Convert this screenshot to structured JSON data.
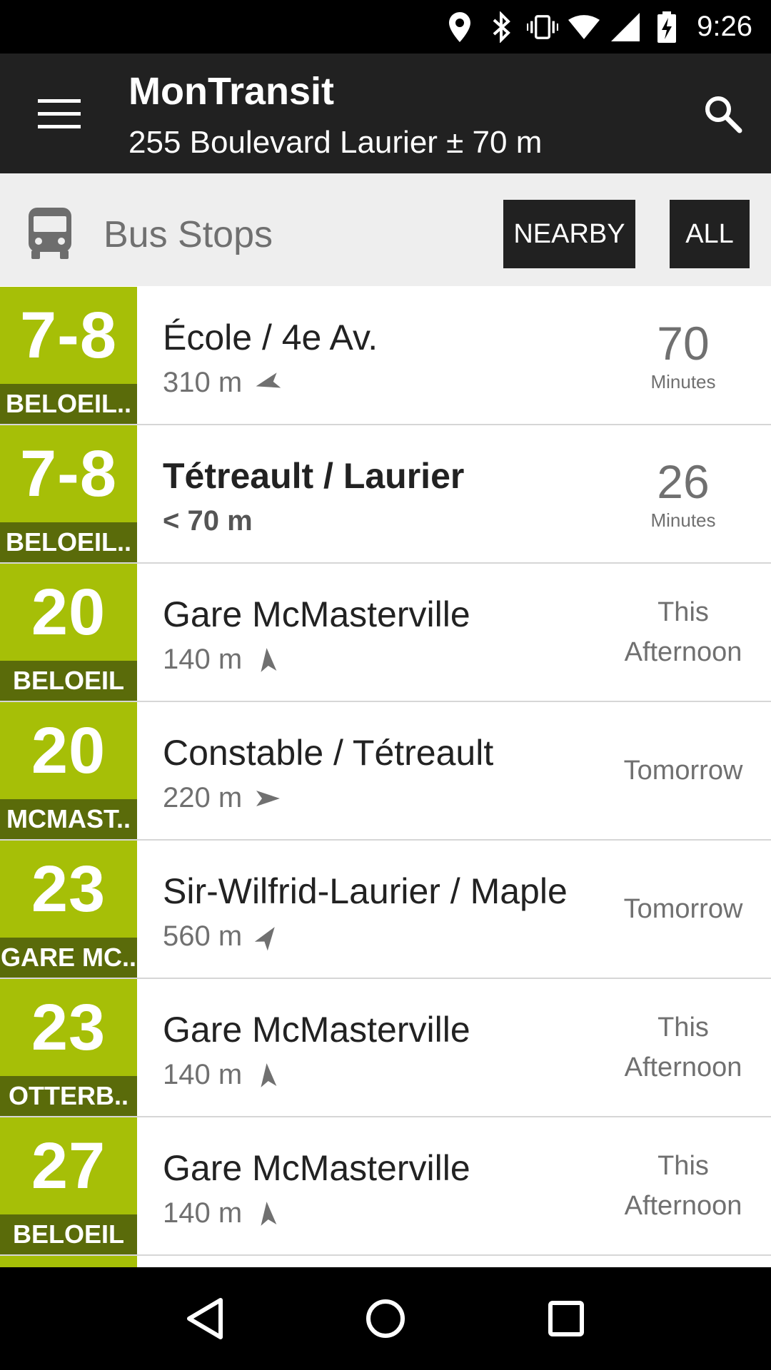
{
  "status_bar": {
    "time": "9:26",
    "icons": [
      "location-icon",
      "bluetooth-icon",
      "vibrate-icon",
      "wifi-icon",
      "cell-signal-icon",
      "battery-charging-icon"
    ]
  },
  "app_bar": {
    "title": "MonTransit",
    "subtitle": "255 Boulevard Laurier ± 70 m",
    "menu_icon": "hamburger-menu-icon",
    "search_icon": "search-icon"
  },
  "section": {
    "icon": "bus-icon",
    "title": "Bus Stops",
    "filters": [
      "NEARBY",
      "ALL"
    ]
  },
  "colors": {
    "route_badge": "#a6bf07",
    "route_direction": "#5a6b0a",
    "app_bar": "#212121"
  },
  "stops": [
    {
      "route": "7-8",
      "direction": "BELOEIL..",
      "name": "École / 4e Av.",
      "distance": "310 m",
      "compass": "arrow-west-southwest",
      "eta_num": "70",
      "eta_unit": "Minutes",
      "eta_text": "",
      "bold": false
    },
    {
      "route": "7-8",
      "direction": "BELOEIL..",
      "name": "Tétreault / Laurier",
      "distance": "< 70 m",
      "compass": "",
      "eta_num": "26",
      "eta_unit": "Minutes",
      "eta_text": "",
      "bold": true
    },
    {
      "route": "20",
      "direction": "BELOEIL",
      "name": "Gare McMasterville",
      "distance": "140 m",
      "compass": "arrow-north",
      "eta_num": "",
      "eta_unit": "",
      "eta_text": "This Afternoon",
      "bold": false
    },
    {
      "route": "20",
      "direction": "MCMAST..",
      "name": "Constable / Tétreault",
      "distance": "220 m",
      "compass": "arrow-east",
      "eta_num": "",
      "eta_unit": "",
      "eta_text": "Tomorrow",
      "bold": false
    },
    {
      "route": "23",
      "direction": "GARE MC..",
      "name": "Sir-Wilfrid-Laurier / Maple",
      "distance": "560 m",
      "compass": "arrow-northeast",
      "eta_num": "",
      "eta_unit": "",
      "eta_text": "Tomorrow",
      "bold": false
    },
    {
      "route": "23",
      "direction": "OTTERB..",
      "name": "Gare McMasterville",
      "distance": "140 m",
      "compass": "arrow-north",
      "eta_num": "",
      "eta_unit": "",
      "eta_text": "This Afternoon",
      "bold": false
    },
    {
      "route": "27",
      "direction": "BELOEIL",
      "name": "Gare McMasterville",
      "distance": "140 m",
      "compass": "arrow-north",
      "eta_num": "",
      "eta_unit": "",
      "eta_text": "This Afternoon",
      "bold": false
    }
  ],
  "nav_bar": {
    "buttons": [
      "back-icon",
      "home-icon",
      "recents-icon"
    ]
  }
}
